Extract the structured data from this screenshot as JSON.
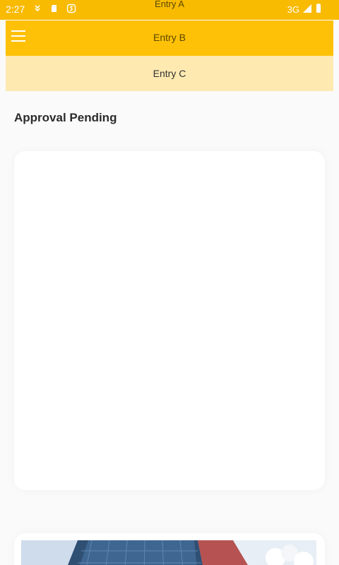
{
  "status_bar": {
    "time": "2:27",
    "center_label": "Entry A",
    "network": "3G",
    "icons": [
      "download-icon",
      "sd-card-icon",
      "s-app-icon",
      "signal-icon",
      "battery-icon"
    ],
    "color": "#f9ba02"
  },
  "toolbar": {
    "title": "Entry B",
    "menu_icon": "menu-icon",
    "color": "#fec107"
  },
  "subbar": {
    "title": "Entry C",
    "color": "#fee9b1"
  },
  "main": {
    "section_title": "Approval Pending"
  }
}
